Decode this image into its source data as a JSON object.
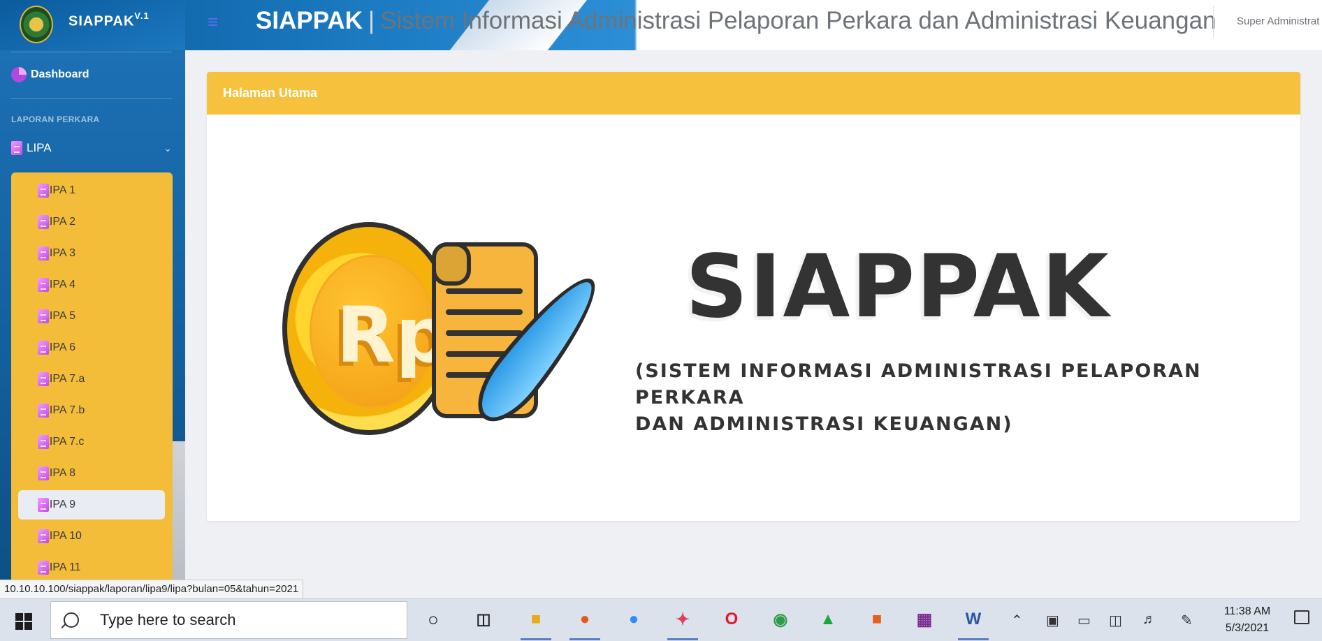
{
  "navbar": {
    "brand": "SIAPPAK",
    "brand_version": "V.1",
    "title_strong": "SIAPPAK",
    "title_separator": "|",
    "title_rest": "Sistem Informasi Administrasi Pelaporan Perkara dan Administrasi Keuangan",
    "user": "Super Administrat"
  },
  "sidebar": {
    "dashboard": "Dashboard",
    "heading": "LAPORAN PERKARA",
    "group": "LIPA",
    "items": [
      "LIPA 1",
      "LIPA 2",
      "LIPA 3",
      "LIPA 4",
      "LIPA 5",
      "LIPA 6",
      "LIPA 7.a",
      "LIPA 7.b",
      "LIPA 7.c",
      "LIPA 8",
      "LIPA 9",
      "LIPA 10",
      "LIPA 11"
    ],
    "active": "LIPA 9"
  },
  "card": {
    "header": "Halaman Utama",
    "logo_coin": "Rp",
    "logo_title": "SIAPPAK",
    "logo_subtitle_line1": "(Sistem Informasi Administrasi Pelaporan Perkara",
    "logo_subtitle_line2": "dan Administrasi Keuangan)"
  },
  "status_url": "10.10.10.100/siappak/laporan/lipa9/lipa?bulan=05&tahun=2021",
  "taskbar": {
    "search_placeholder": "Type here to search",
    "time": "11:38 AM",
    "date": "5/3/2021"
  },
  "colors": {
    "sidebar_blue": "#1c70b4",
    "accent_yellow": "#f6c23e",
    "submenu_yellow": "#f3bd3a",
    "active_item": "#e9ecf3"
  }
}
